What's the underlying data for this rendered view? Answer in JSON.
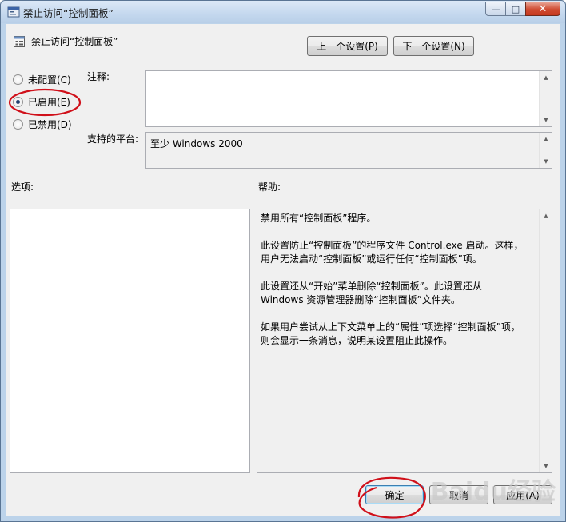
{
  "window": {
    "title": "禁止访问“控制面板”",
    "buttons": {
      "minimize": "—",
      "maximize": "□",
      "close": "✕"
    }
  },
  "policy": {
    "title": "禁止访问“控制面板”",
    "prev_label": "上一个设置(P)",
    "next_label": "下一个设置(N)"
  },
  "state": {
    "options": [
      {
        "label": "未配置(C)",
        "checked": false
      },
      {
        "label": "已启用(E)",
        "checked": true
      },
      {
        "label": "已禁用(D)",
        "checked": false
      }
    ]
  },
  "comment": {
    "label": "注释:",
    "value": ""
  },
  "platform": {
    "label": "支持的平台:",
    "value": "至少 Windows 2000"
  },
  "options_section": {
    "label": "选项:"
  },
  "help": {
    "label": "帮助:",
    "text": "禁用所有“控制面板”程序。\n\n此设置防止“控制面板”的程序文件 Control.exe 启动。这样，\n用户无法启动“控制面板”或运行任何“控制面板”项。\n\n此设置还从“开始”菜单删除“控制面板”。此设置还从\nWindows 资源管理器删除“控制面板”文件夹。\n\n如果用户尝试从上下文菜单上的“属性”项选择“控制面板”项，\n则会显示一条消息，说明某设置阻止此操作。"
  },
  "footer": {
    "ok_label": "确定",
    "cancel_label": "取消",
    "apply_label": "应用(A)"
  },
  "watermark": "Baidu经验",
  "colors": {
    "annotation": "#d0101a",
    "frame": "#bcd3ea",
    "client": "#f0f0f0"
  }
}
